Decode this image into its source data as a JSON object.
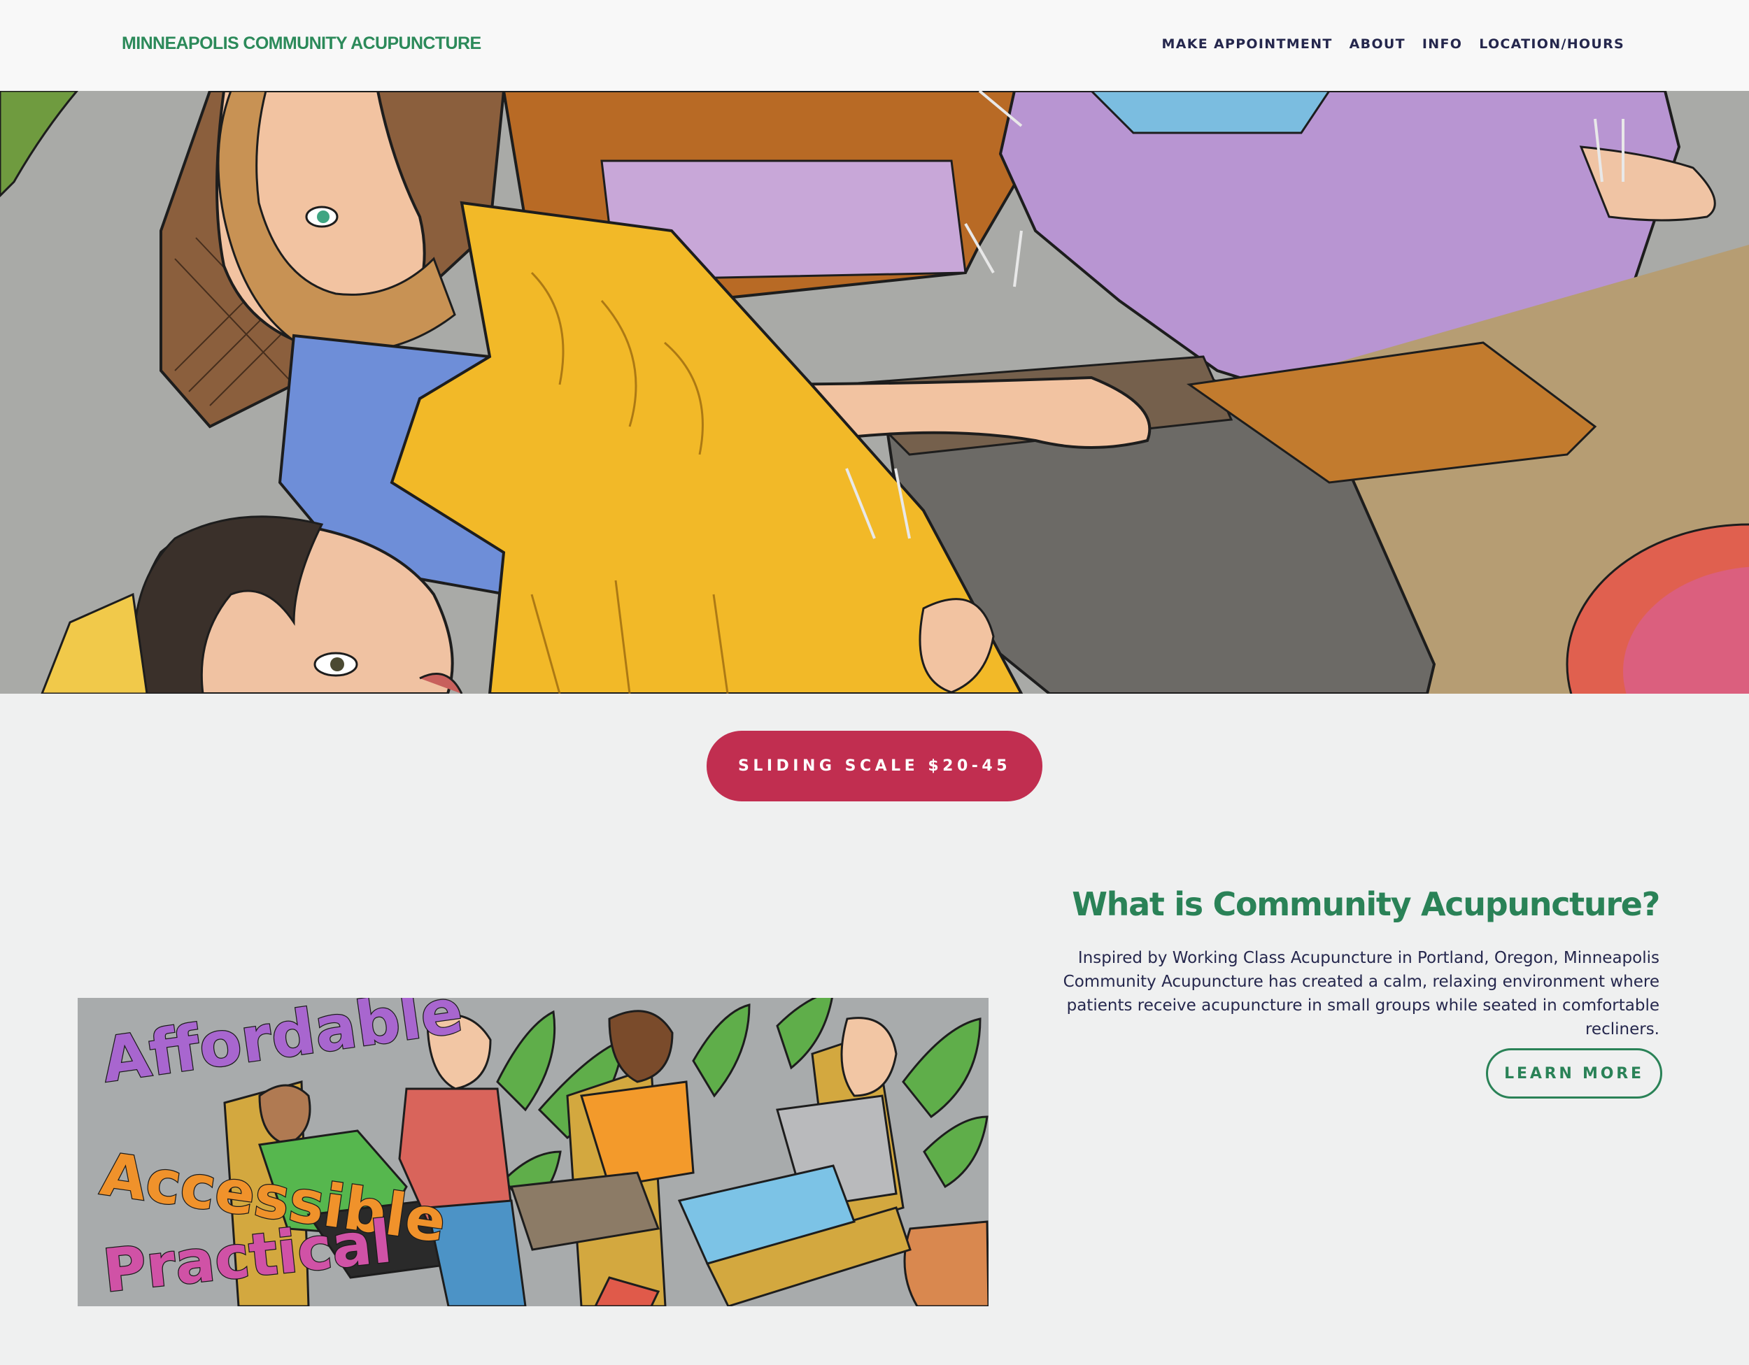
{
  "header": {
    "site_title": "MINNEAPOLIS COMMUNITY ACUPUNCTURE",
    "nav": [
      {
        "label": "MAKE APPOINTMENT"
      },
      {
        "label": "ABOUT"
      },
      {
        "label": "INFO"
      },
      {
        "label": "LOCATION/HOURS"
      }
    ]
  },
  "hero": {
    "image": "illustration-patients-receiving-acupuncture"
  },
  "cta": {
    "label": "SLIDING SCALE $20-45"
  },
  "section": {
    "title": "What is Community Acupuncture?",
    "body": "Inspired by Working Class Acupuncture in Portland, Oregon, Minneapolis Community Acupuncture has created a calm, relaxing environment where patients receive acupuncture in small groups while seated in comfortable recliners.",
    "button": "LEARN MORE",
    "banner_words": [
      "Affordable",
      "Accessible",
      "Practical"
    ]
  },
  "colors": {
    "brand_green": "#2c8a5a",
    "nav_text": "#25274d",
    "cta_red": "#c12e50",
    "page_bg": "#eff0f0"
  }
}
